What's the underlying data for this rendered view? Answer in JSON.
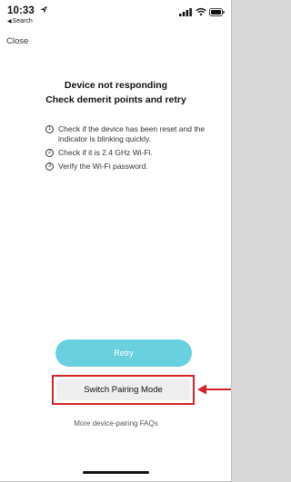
{
  "status_bar": {
    "time": "10:33",
    "back_app": "Search",
    "icons": [
      "location-arrow-icon",
      "signal-icon",
      "wifi-icon",
      "battery-icon"
    ]
  },
  "nav": {
    "close_label": "Close"
  },
  "titles": {
    "line1": "Device not responding",
    "line2": "Check demerit points and retry"
  },
  "instructions": [
    {
      "num": "1",
      "text": "Check if the device has been reset and the indicator is blinking quickly."
    },
    {
      "num": "2",
      "text": "Check if it is 2.4 GHz Wi-Fi."
    },
    {
      "num": "3",
      "text": "Verify the Wi-Fi password."
    }
  ],
  "buttons": {
    "retry": "Retry",
    "switch_mode": "Switch Pairing Mode"
  },
  "faq_link": "More device-pairing FAQs",
  "colors": {
    "retry_bg": "#69d0e0",
    "highlight": "#d2232a",
    "switch_bg": "#eeeeee"
  }
}
